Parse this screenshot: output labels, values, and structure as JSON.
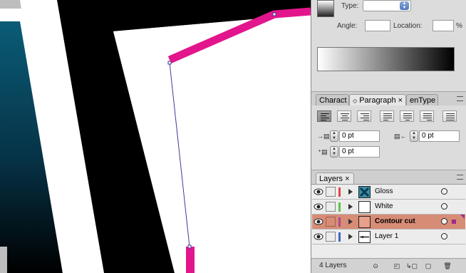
{
  "colors": {
    "path_magenta": "#e3158c",
    "selection_accent": "#9c2c86",
    "selected_layer_bg": "#d78c76",
    "teal_gradient_top": "#0a5c77",
    "panel_bg": "#dcdcdc"
  },
  "gradient_panel": {
    "type_label": "Type:",
    "angle_label": "Angle:",
    "angle_value": "",
    "location_label": "Location:",
    "location_value": "",
    "location_unit": "%"
  },
  "type_panel": {
    "tabs": [
      {
        "label": "Charact",
        "active": false
      },
      {
        "label": "Paragraph",
        "active": true
      },
      {
        "label": "enType",
        "active": false
      }
    ],
    "close_glyph": "×",
    "tab_arrows": "◇",
    "alignment_icons": [
      "align-left-icon",
      "align-center-icon",
      "align-right-icon",
      "justify-left-icon",
      "justify-center-icon",
      "justify-right-icon",
      "justify-all-icon"
    ],
    "left_indent": "0 pt",
    "right_indent": "0 pt",
    "first_line_indent": "0 pt"
  },
  "layers_panel": {
    "tab_label": "Layers",
    "close_glyph": "×",
    "layers": [
      {
        "name": "Gloss",
        "color": "#e0453c",
        "selected": false,
        "has_selection": false
      },
      {
        "name": "White",
        "color": "#5fc24a",
        "selected": false,
        "has_selection": false
      },
      {
        "name": "Contour cut",
        "color": "#a84b8f",
        "selected": true,
        "has_selection": true
      },
      {
        "name": "Layer 1",
        "color": "#3f64c8",
        "selected": false,
        "has_selection": false
      }
    ],
    "count_label": "4 Layers"
  }
}
